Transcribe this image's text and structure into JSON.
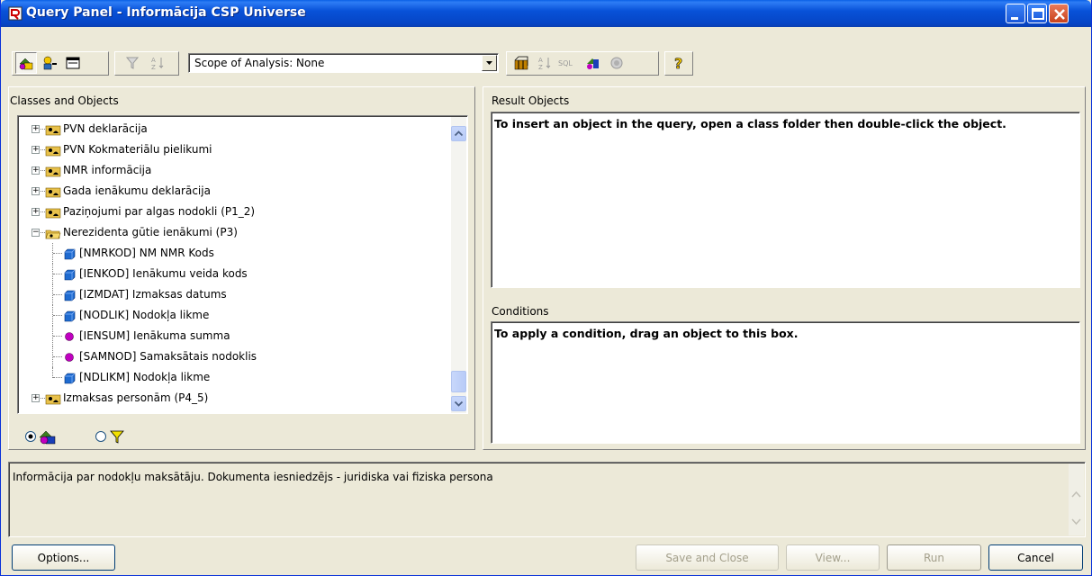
{
  "window": {
    "title": "Query Panel - Informācija CSP Universe"
  },
  "toolbar": {
    "scope_label": "Scope of Analysis: None",
    "icons": [
      "classes-objects-icon",
      "operators-icon",
      "predefined-conditions-icon",
      "filter-icon",
      "sort-icon",
      "universe-icon",
      "sort-order-icon",
      "sql-icon",
      "palette-icon",
      "disabled-icon",
      "help-icon"
    ]
  },
  "left_panel": {
    "label": "Classes and Objects",
    "tree": [
      {
        "label": "PVN deklarācija",
        "type": "class",
        "expanded": false
      },
      {
        "label": "PVN Kokmateriālu pielikumi",
        "type": "class",
        "expanded": false
      },
      {
        "label": "NMR informācija",
        "type": "class",
        "expanded": false
      },
      {
        "label": "Gada ienākumu deklarācija",
        "type": "class",
        "expanded": false
      },
      {
        "label": "Paziņojumi par algas nodokli (P1_2)",
        "type": "class",
        "expanded": false
      },
      {
        "label": "Nerezidenta gūtie ienākumi (P3)",
        "type": "class-open",
        "expanded": true
      },
      {
        "label": "[NMRKOD] NM NMR Kods",
        "type": "dimension"
      },
      {
        "label": "[IENKOD] Ienākumu veida kods",
        "type": "dimension"
      },
      {
        "label": "[IZMDAT] Izmaksas datums",
        "type": "dimension"
      },
      {
        "label": "[NODLIK] Nodokļa likme",
        "type": "dimension"
      },
      {
        "label": "[IENSUM] Ienākuma summa",
        "type": "measure"
      },
      {
        "label": "[SAMNOD] Samaksātais nodoklis",
        "type": "measure"
      },
      {
        "label": "[NDLIKM] Nodokļa likme",
        "type": "dimension"
      },
      {
        "label": "Izmaksas personām (P4_5)",
        "type": "class",
        "expanded": false
      }
    ],
    "radio_selected": "objects"
  },
  "right_panel": {
    "result_label": "Result Objects",
    "result_hint": "To insert an object in the query, open a class folder then double-click the object.",
    "conditions_label": "Conditions",
    "conditions_hint": "To apply a condition, drag an object to this box."
  },
  "description": {
    "text": "Informācija par nodokļu maksātāju. Dokumenta iesniedzējs - juridiska vai fiziska persona"
  },
  "buttons": {
    "options": "Options...",
    "save_close": "Save and Close",
    "view": "View...",
    "run": "Run",
    "cancel": "Cancel"
  }
}
